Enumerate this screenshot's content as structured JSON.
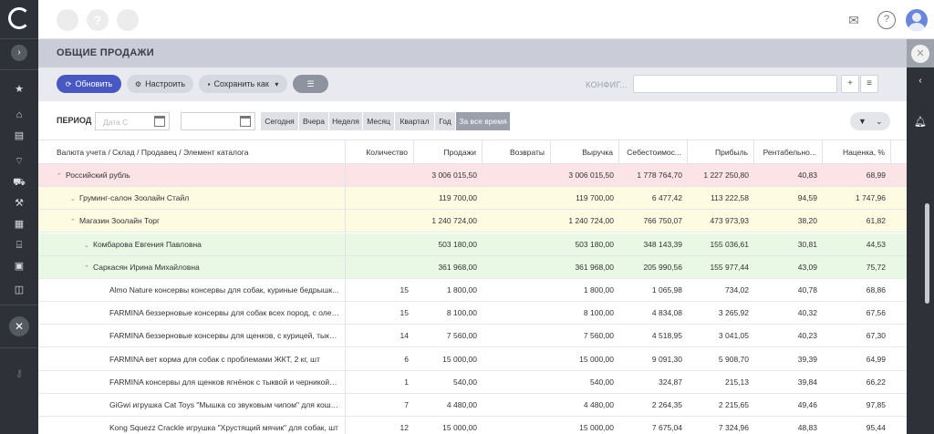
{
  "sidebar": {
    "items": [
      {
        "icon": "star-icon",
        "glyph": "★"
      },
      {
        "icon": "store-icon",
        "glyph": "⌂"
      },
      {
        "icon": "book-icon",
        "glyph": "▤"
      },
      {
        "icon": "basket-icon",
        "glyph": "⌔"
      },
      {
        "icon": "truck-icon",
        "glyph": "⛟"
      },
      {
        "icon": "tools-icon",
        "glyph": "⚒"
      },
      {
        "icon": "chart-icon",
        "glyph": "▦"
      },
      {
        "icon": "bank-icon",
        "glyph": "⌸"
      },
      {
        "icon": "wallet-icon",
        "glyph": "▣"
      },
      {
        "icon": "box-icon",
        "glyph": "◫"
      }
    ],
    "bottom_icon": {
      "icon": "key-icon",
      "glyph": "⚷"
    }
  },
  "topbar": {
    "help_glyph": "?"
  },
  "page": {
    "title": "ОБЩИЕ ПРОДАЖИ"
  },
  "toolbar": {
    "refresh_label": "Обновить",
    "configure_label": "Настроить",
    "save_as_label": "Сохранить как",
    "config_label": "КОНФИГ...",
    "config_value": "",
    "add_glyph": "+",
    "list_glyph": "≡"
  },
  "period": {
    "label": "ПЕРИОД",
    "date_from_placeholder": "Дата С",
    "date_to_placeholder": "",
    "dash": "-",
    "options": [
      "Сегодня",
      "Вчера",
      "Неделя",
      "Месяц",
      "Квартал",
      "Год",
      "За все время"
    ],
    "active": "За все время"
  },
  "table": {
    "columns": [
      "Валюта учета / Склад / Продавец / Элемент каталога",
      "Количество",
      "Продажи",
      "Возвраты",
      "Выручка",
      "Себестоимос...",
      "Прибыль",
      "Рентабельно...",
      "Наценка, %"
    ],
    "rows": [
      {
        "level": 0,
        "arrow": "^",
        "name": "Российский рубль",
        "qty": "",
        "sales": "3 006 015,50",
        "returns": "",
        "revenue": "3 006 015,50",
        "cost": "1 778 764,70",
        "profit": "1 227 250,80",
        "rent": "40,83",
        "markup": "68,99"
      },
      {
        "level": 1,
        "arrow": "v",
        "name": "Груминг-салон Зоолайн Стайл",
        "qty": "",
        "sales": "119 700,00",
        "returns": "",
        "revenue": "119 700,00",
        "cost": "6 477,42",
        "profit": "113 222,58",
        "rent": "94,59",
        "markup": "1 747,96"
      },
      {
        "level": 1,
        "arrow": "^",
        "name": "Магазин Зоолайн Торг",
        "qty": "",
        "sales": "1 240 724,00",
        "returns": "",
        "revenue": "1 240 724,00",
        "cost": "766 750,07",
        "profit": "473 973,93",
        "rent": "38,20",
        "markup": "61,82"
      },
      {
        "level": 2,
        "arrow": "v",
        "name": "Комбарова Евгения Павловна",
        "qty": "",
        "sales": "503 180,00",
        "returns": "",
        "revenue": "503 180,00",
        "cost": "348 143,39",
        "profit": "155 036,61",
        "rent": "30,81",
        "markup": "44,53"
      },
      {
        "level": 2,
        "arrow": "^",
        "name": "Саркасян Ирина Михайловна",
        "qty": "",
        "sales": "361 968,00",
        "returns": "",
        "revenue": "361 968,00",
        "cost": "205 990,56",
        "profit": "155 977,44",
        "rent": "43,09",
        "markup": "75,72"
      },
      {
        "level": 3,
        "arrow": "",
        "name": "Almo Nature консервы консервы для собак, куриные бедрышк...",
        "qty": "15",
        "sales": "1 800,00",
        "returns": "",
        "revenue": "1 800,00",
        "cost": "1 065,98",
        "profit": "734,02",
        "rent": "40,78",
        "markup": "68,86"
      },
      {
        "level": 3,
        "arrow": "",
        "name": "FARMINA беззерновые консервы для собак всех пород, с олен...",
        "qty": "15",
        "sales": "8 100,00",
        "returns": "",
        "revenue": "8 100,00",
        "cost": "4 834,08",
        "profit": "3 265,92",
        "rent": "40,32",
        "markup": "67,56"
      },
      {
        "level": 3,
        "arrow": "",
        "name": "FARMINA беззерновые консервы для щенков, с курицей, тыкв...",
        "qty": "14",
        "sales": "7 560,00",
        "returns": "",
        "revenue": "7 560,00",
        "cost": "4 518,95",
        "profit": "3 041,05",
        "rent": "40,23",
        "markup": "67,30"
      },
      {
        "level": 3,
        "arrow": "",
        "name": "FARMINA вет корма для собак с проблемами ЖКТ, 2 кг, шт",
        "qty": "6",
        "sales": "15 000,00",
        "returns": "",
        "revenue": "15 000,00",
        "cost": "9 091,30",
        "profit": "5 908,70",
        "rent": "39,39",
        "markup": "64,99"
      },
      {
        "level": 3,
        "arrow": "",
        "name": "FARMINA консервы для щенков ягнёнок с тыквой и черникой, ...",
        "qty": "1",
        "sales": "540,00",
        "returns": "",
        "revenue": "540,00",
        "cost": "324,87",
        "profit": "215,13",
        "rent": "39,84",
        "markup": "66,22"
      },
      {
        "level": 3,
        "arrow": "",
        "name": "GiGwi игрушка Cat Toys \"Мышка со звуковым чипом\" для кошe...",
        "qty": "7",
        "sales": "4 480,00",
        "returns": "",
        "revenue": "4 480,00",
        "cost": "2 264,35",
        "profit": "2 215,65",
        "rent": "49,46",
        "markup": "97,85"
      },
      {
        "level": 3,
        "arrow": "",
        "name": "Kong Squezz Crackle игрушка \"Хрустящий мячик\" для собак, шт",
        "qty": "12",
        "sales": "15 000,00",
        "returns": "",
        "revenue": "15 000,00",
        "cost": "7 675,04",
        "profit": "7 324,96",
        "rent": "48,83",
        "markup": "95,44"
      }
    ]
  },
  "colors": {
    "primary": "#4958c0",
    "sidebar": "#2e3138",
    "row_currency": "#fbe3e6",
    "row_store": "#fdfbe2",
    "row_seller": "#e9f8e4"
  }
}
